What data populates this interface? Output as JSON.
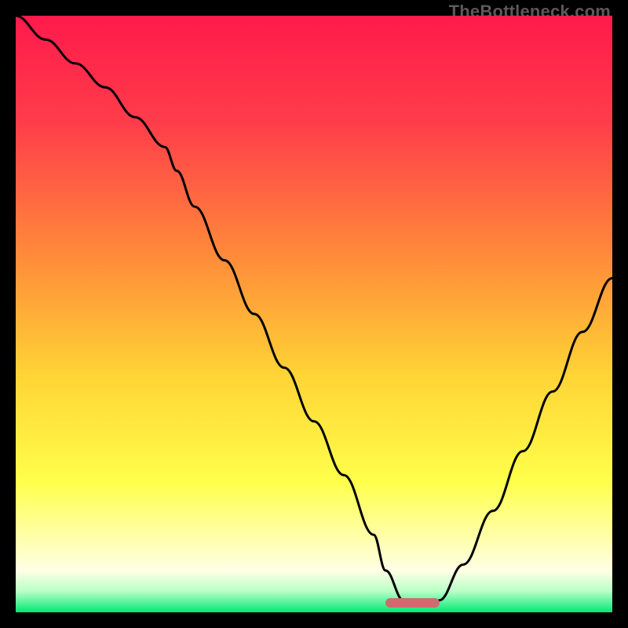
{
  "watermark": "TheBottleneck.com",
  "colors": {
    "gradient_stops": [
      {
        "offset": 0.0,
        "color": "#ff1a4b"
      },
      {
        "offset": 0.18,
        "color": "#ff3d4a"
      },
      {
        "offset": 0.4,
        "color": "#ff8a3a"
      },
      {
        "offset": 0.6,
        "color": "#ffd335"
      },
      {
        "offset": 0.78,
        "color": "#ffff4a"
      },
      {
        "offset": 0.88,
        "color": "#ffffb0"
      },
      {
        "offset": 0.93,
        "color": "#ffffe6"
      },
      {
        "offset": 0.965,
        "color": "#b8ffc6"
      },
      {
        "offset": 1.0,
        "color": "#00e873"
      }
    ],
    "curve": "#000000",
    "marker": "#d06a70",
    "frame": "#000000"
  },
  "chart_data": {
    "type": "line",
    "title": "",
    "xlabel": "",
    "ylabel": "",
    "xlim": [
      0,
      100
    ],
    "ylim": [
      0,
      100
    ],
    "grid": false,
    "legend": false,
    "marker_x_range": [
      62,
      71
    ],
    "series": [
      {
        "name": "bottleneck-curve",
        "x": [
          0,
          5,
          10,
          15,
          20,
          25,
          27,
          30,
          35,
          40,
          45,
          50,
          55,
          60,
          62,
          65,
          68,
          71,
          75,
          80,
          85,
          90,
          95,
          100
        ],
        "y": [
          100,
          96,
          92,
          88,
          83,
          78,
          74,
          68,
          59,
          50,
          41,
          32,
          23,
          13,
          7,
          2,
          1,
          2,
          8,
          17,
          27,
          37,
          47,
          56
        ]
      }
    ]
  }
}
